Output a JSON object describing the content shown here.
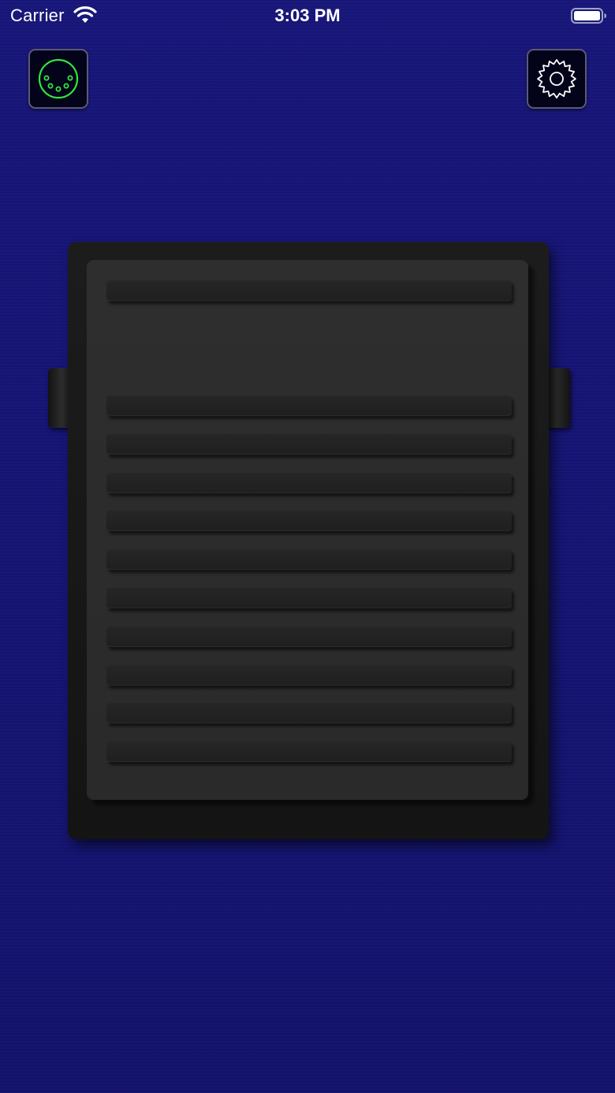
{
  "status_bar": {
    "carrier": "Carrier",
    "time": "3:03 PM",
    "wifi_icon": "wifi-icon",
    "battery_icon": "battery-icon"
  },
  "toolbar": {
    "midi_button_icon": "midi-connector-icon",
    "settings_button_icon": "gear-icon",
    "midi_icon_color": "#2ee83a",
    "settings_icon_color": "#ffffff"
  },
  "pedal": {
    "ridge_count": 11,
    "plate_color": "#2c2c2c",
    "base_color": "#171717"
  },
  "colors": {
    "background": "#15146e"
  }
}
